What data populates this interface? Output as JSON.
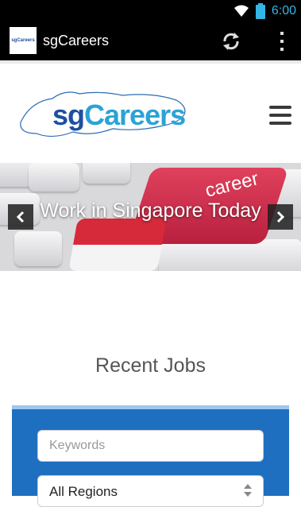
{
  "status_bar": {
    "time": "6:00"
  },
  "action_bar": {
    "title": "sgCareers",
    "icon_text": "sgCareers"
  },
  "header": {
    "logo_sg": "sg",
    "logo_careers": "Careers"
  },
  "banner": {
    "caption": "Work in Singapore Today",
    "key_label": "career"
  },
  "recent_jobs": {
    "title": "Recent Jobs"
  },
  "search": {
    "keywords_placeholder": "Keywords",
    "region_value": "All Regions"
  },
  "colors": {
    "panel": "#1f6fc0",
    "status_time": "#33b5e5",
    "logo_dark": "#1e4fa0",
    "logo_light": "#2aa3d6"
  }
}
